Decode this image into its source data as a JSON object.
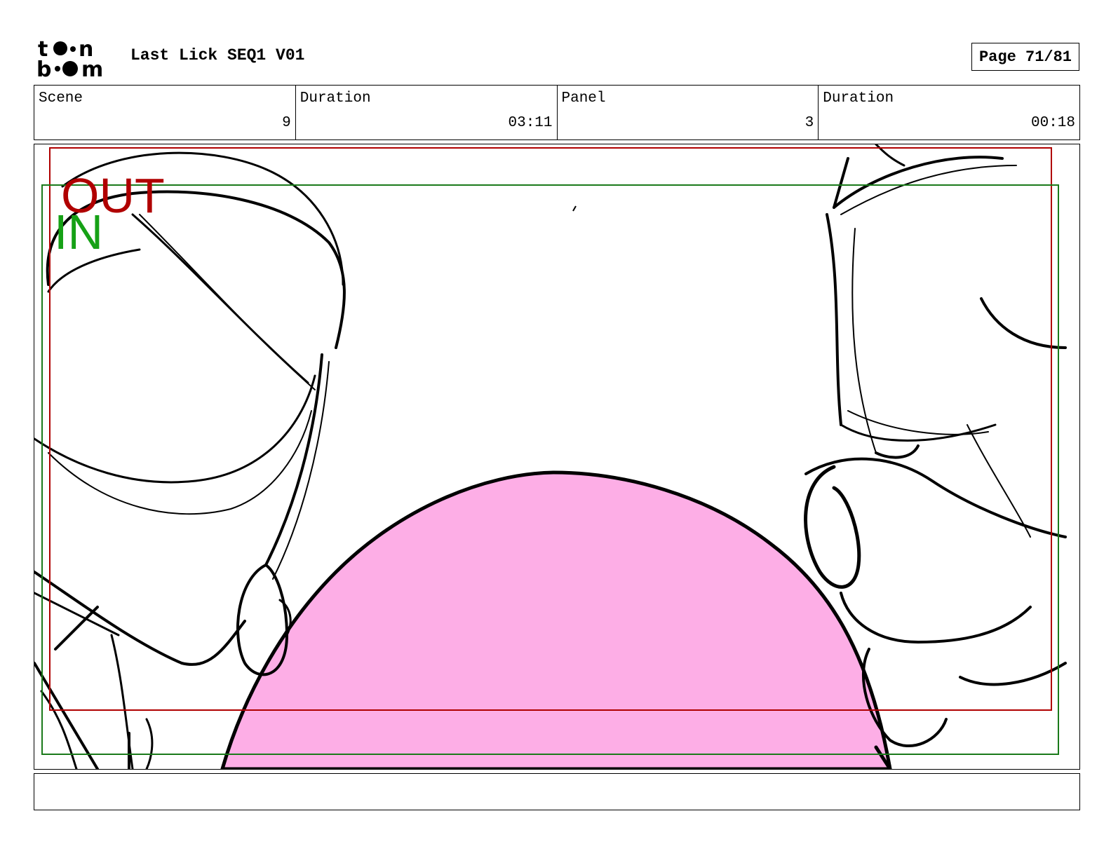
{
  "header": {
    "logo_top": "toon",
    "logo_bottom": "boom",
    "project_title": "Last Lick SEQ1 V01",
    "page_label": "Page",
    "page_current": "71",
    "page_total": "81",
    "page_text": "Page 71/81"
  },
  "info": {
    "scene_label": "Scene",
    "scene_value": "9",
    "scene_duration_label": "Duration",
    "scene_duration_value": "03:11",
    "panel_label": "Panel",
    "panel_value": "3",
    "panel_duration_label": "Duration",
    "panel_duration_value": "00:18"
  },
  "panel": {
    "out_label": "OUT",
    "in_label": "IN",
    "colors": {
      "out_frame": "#b00000",
      "in_frame": "#1a7a1a",
      "in_text": "#16a116",
      "bubble_fill": "#fdaee6",
      "ink": "#000000"
    }
  },
  "notes": {
    "text": ""
  }
}
